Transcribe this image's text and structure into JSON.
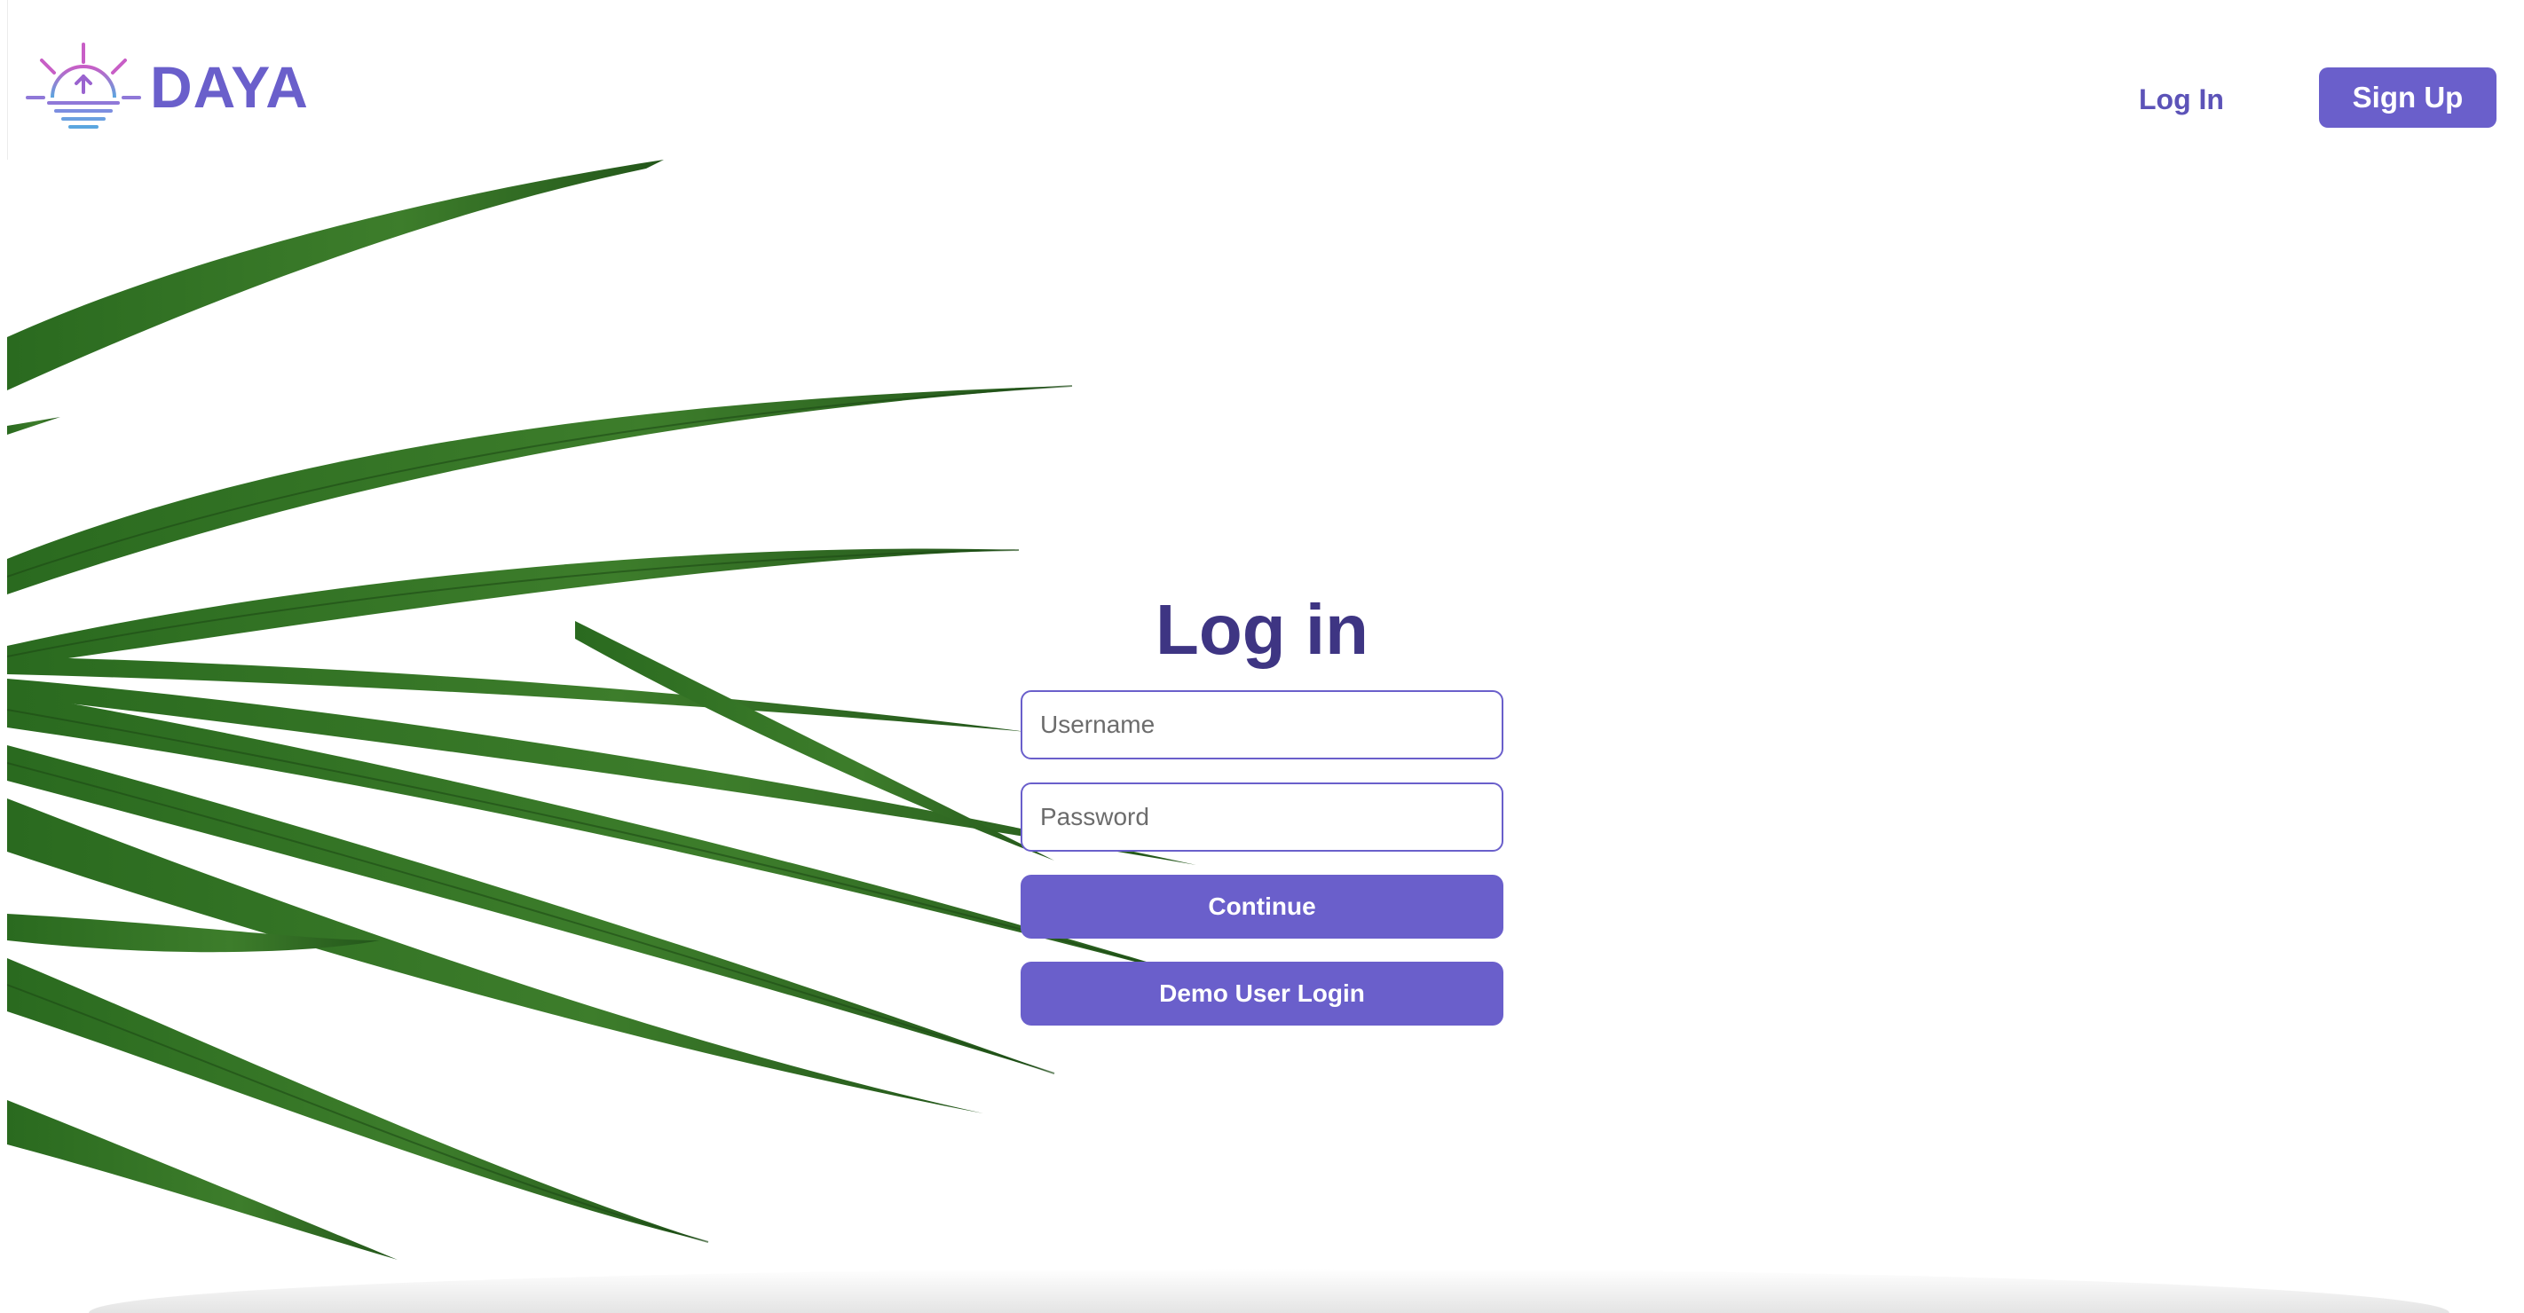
{
  "brand": {
    "name": "DAYA",
    "logo_icon": "sunrise-logo-icon"
  },
  "nav": {
    "login_label": "Log In",
    "signup_label": "Sign Up"
  },
  "login_form": {
    "title": "Log in",
    "username_placeholder": "Username",
    "password_placeholder": "Password",
    "continue_label": "Continue",
    "demo_label": "Demo User Login"
  },
  "colors": {
    "accent": "#6a5fcb",
    "title": "#3e3583",
    "leaf": "#2f6b23",
    "logo_sun": "#b75fcb",
    "logo_water": "#5fa6d8"
  }
}
